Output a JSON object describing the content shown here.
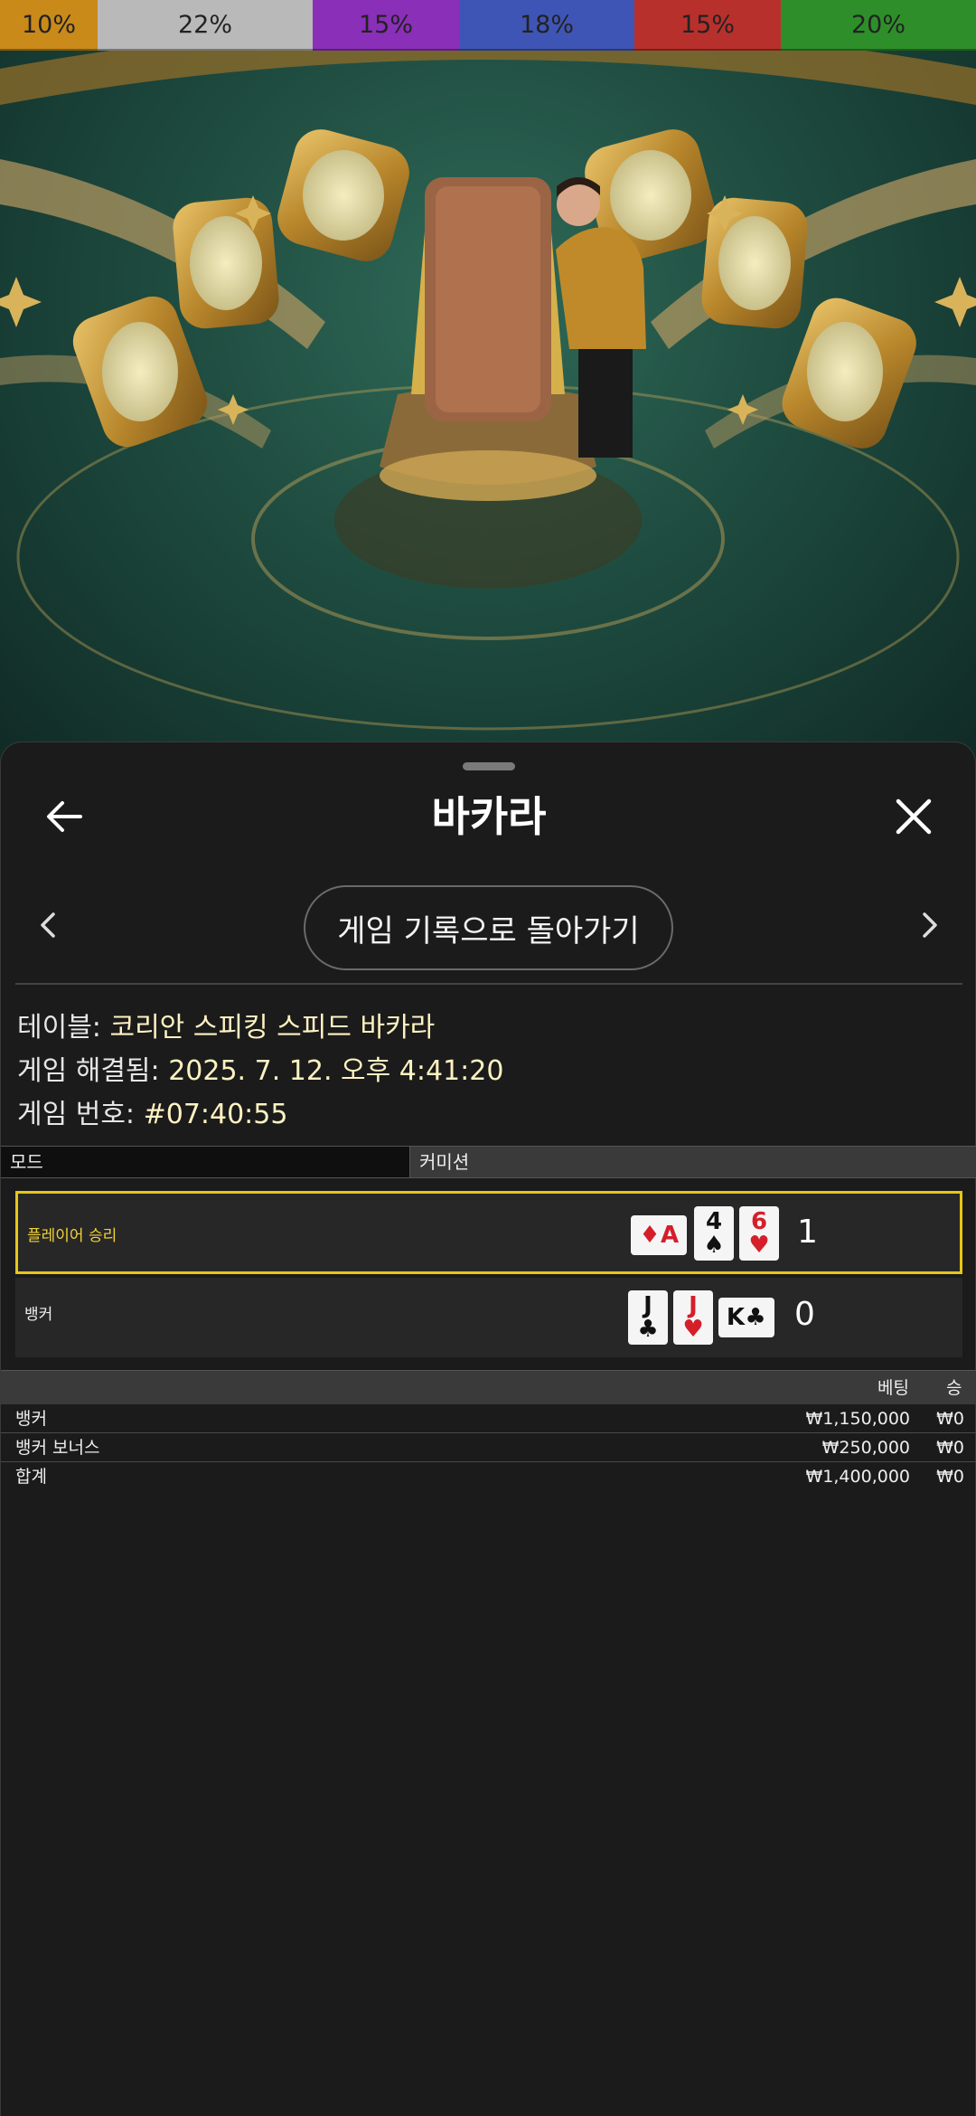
{
  "top_bar": {
    "segments": [
      {
        "label": "10%",
        "color": "#c98a1a",
        "weight": 10
      },
      {
        "label": "22%",
        "color": "#b9b9b9",
        "weight": 22
      },
      {
        "label": "15%",
        "color": "#8a2fb8",
        "weight": 15
      },
      {
        "label": "18%",
        "color": "#3f55b5",
        "weight": 18
      },
      {
        "label": "15%",
        "color": "#b8302c",
        "weight": 15
      },
      {
        "label": "20%",
        "color": "#2e8f2a",
        "weight": 20
      }
    ]
  },
  "sheet": {
    "title": "바카라",
    "history_button": "게임 기록으로 돌아가기",
    "info": {
      "table_label": "테이블:",
      "table_value": "코리안 스피킹 스피드 바카라",
      "resolved_label": "게임 해결됨:",
      "resolved_value": "2025. 7. 12. 오후 4:41:20",
      "number_label": "게임 번호:",
      "number_value": "#07:40:55"
    },
    "mode_header": {
      "mode": "모드",
      "commission": "커미션"
    },
    "results": [
      {
        "label": "플레이어 승리",
        "winner": true,
        "cards": [
          {
            "rank": "A",
            "suit": "♦",
            "color": "red",
            "sideways": true
          },
          {
            "rank": "4",
            "suit": "♠",
            "color": "black",
            "sideways": false
          },
          {
            "rank": "6",
            "suit": "♥",
            "color": "red",
            "sideways": false
          }
        ],
        "score": "1"
      },
      {
        "label": "뱅커",
        "winner": false,
        "cards": [
          {
            "rank": "J",
            "suit": "♣",
            "color": "black",
            "sideways": false
          },
          {
            "rank": "J",
            "suit": "♥",
            "color": "red",
            "sideways": false
          },
          {
            "rank": "K",
            "suit": "♣",
            "color": "black",
            "sideways": true
          }
        ],
        "score": "0"
      }
    ],
    "bets": {
      "headers": {
        "bet": "베팅",
        "win": "승"
      },
      "rows": [
        {
          "name": "뱅커",
          "bet": "₩1,150,000",
          "win": "₩0"
        },
        {
          "name": "뱅커 보너스",
          "bet": "₩250,000",
          "win": "₩0"
        },
        {
          "name": "합계",
          "bet": "₩1,400,000",
          "win": "₩0"
        }
      ]
    }
  }
}
